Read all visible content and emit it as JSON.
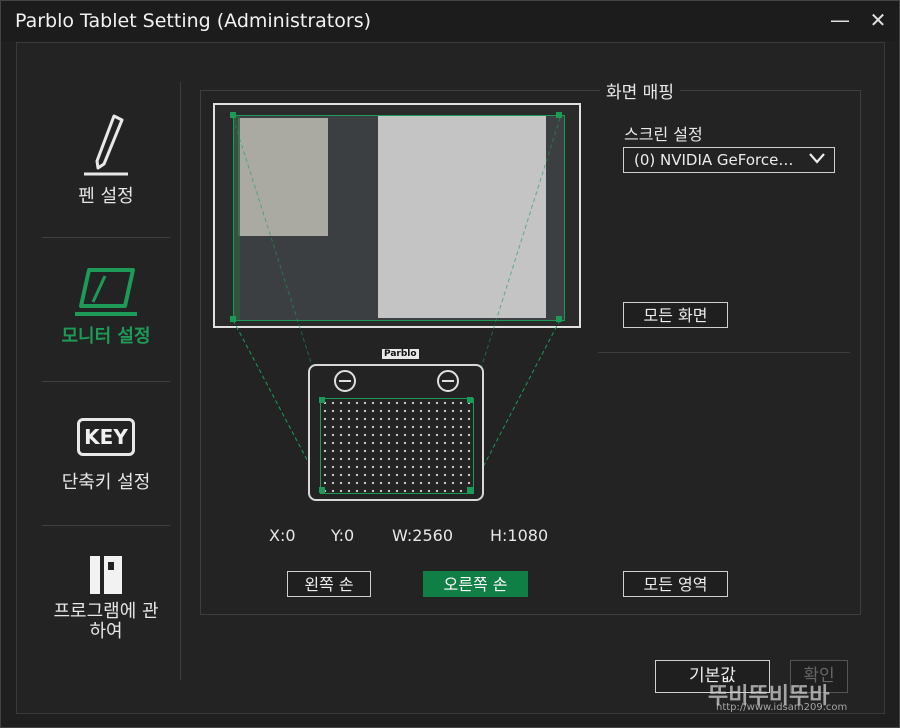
{
  "window": {
    "title": "Parblo Tablet Setting (Administrators)",
    "minimize": "—",
    "close": "✕"
  },
  "sidebar": {
    "items": [
      {
        "label": "펜 설정",
        "icon": "pen-icon",
        "active": false
      },
      {
        "label": "모니터 설정",
        "icon": "monitor-icon",
        "active": true
      },
      {
        "label": "단축키 설정",
        "icon": "key-icon",
        "icon_text": "KEY",
        "active": false
      },
      {
        "label": "프로그램에 관\n하여",
        "icon": "info-icon",
        "active": false
      }
    ]
  },
  "mapping": {
    "group_title": "화면 매핑",
    "screen_label": "스크린 설정",
    "screen_select": "(0) NVIDIA GeForce…",
    "all_screens_button": "모든 화면",
    "tablet_brand": "Parblo",
    "coords": {
      "x": "X:0",
      "y": "Y:0",
      "w": "W:2560",
      "h": "H:1080"
    },
    "left_hand_button": "왼쪽 손",
    "right_hand_button": "오른쪽 손",
    "all_area_button": "모든 영역"
  },
  "footer": {
    "default_button": "기본값",
    "ok_button": "확인"
  },
  "watermark": {
    "main": "뚜비뚜비뚜바",
    "sub": "http://www.idsam209.com"
  },
  "colors": {
    "accent": "#1d9a57",
    "button_green": "#0f7f46",
    "background": "#232323"
  }
}
